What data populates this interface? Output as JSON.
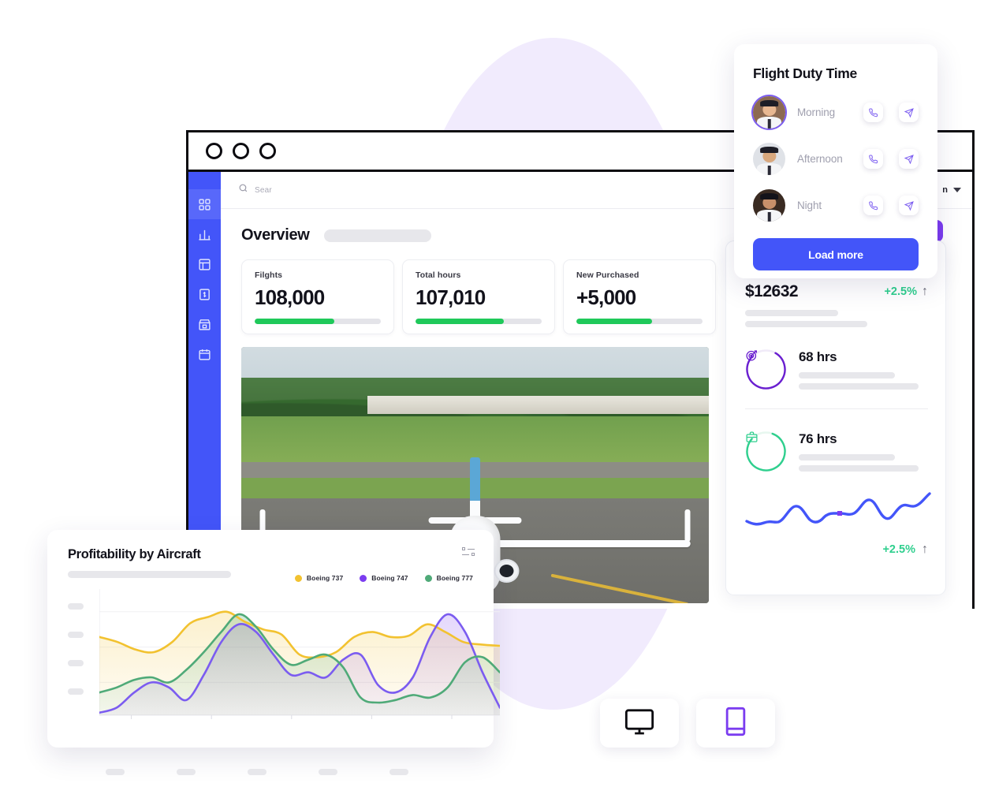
{
  "browser": {
    "window_dots": [
      "dot-1",
      "dot-2",
      "dot-3"
    ]
  },
  "sidebar": {
    "items": [
      {
        "name": "dashboard",
        "icon": "grid-icon",
        "active": true
      },
      {
        "name": "analytics",
        "icon": "bar-chart-icon",
        "active": false
      },
      {
        "name": "table",
        "icon": "table-icon",
        "active": false
      },
      {
        "name": "billing",
        "icon": "invoice-icon",
        "active": false
      },
      {
        "name": "store",
        "icon": "storefront-icon",
        "active": false
      },
      {
        "name": "calendar",
        "icon": "calendar-icon",
        "active": false
      }
    ]
  },
  "topbar": {
    "search_placeholder": "Sear",
    "search_value": "",
    "user_name": "n",
    "dropdown_icon": "chevron-down-icon"
  },
  "overview": {
    "title": "Overview",
    "cards": [
      {
        "label": "Filghts",
        "value": "108,000",
        "progress": 63,
        "color": "#1fc95a"
      },
      {
        "label": "Total hours",
        "value": "107,010",
        "progress": 70,
        "color": "#1fc95a"
      },
      {
        "label": "New Purchased",
        "value": "+5,000",
        "progress": 60,
        "color": "#1fc95a"
      }
    ]
  },
  "photo": {
    "alt": "airplane-on-runway"
  },
  "right_panel": {
    "amount": "$12632",
    "amount_delta": "+2.5%",
    "amount_delta_icon": "arrow-up-icon",
    "metrics": [
      {
        "value": "68 hrs",
        "icon": "target-icon",
        "ring_color": "#6a1fd0",
        "ring_pct": 78
      },
      {
        "value": "76 hrs",
        "icon": "briefcase-icon",
        "ring_color": "#2fcf8e",
        "ring_pct": 80
      }
    ],
    "spark_delta": "+2.5%",
    "spark_delta_icon": "arrow-up-icon",
    "spark_color": "#4355f9",
    "spark_marker_color": "#7b3cf0"
  },
  "duty_card": {
    "title": "Flight Duty Time",
    "rows": [
      {
        "label": "Morning",
        "avatar": "pilot-avatar-morning",
        "bg": "#8c6a52",
        "skin": "#e8b892",
        "highlight": true,
        "call_icon": "phone-icon",
        "send_icon": "send-icon"
      },
      {
        "label": "Afternoon",
        "avatar": "pilot-avatar-afternoon",
        "bg": "#dfe2e7",
        "skin": "#d8a87e",
        "highlight": false,
        "call_icon": "phone-icon",
        "send_icon": "send-icon"
      },
      {
        "label": "Night",
        "avatar": "pilot-avatar-night",
        "bg": "#3a2b22",
        "skin": "#c8906a",
        "highlight": false,
        "call_icon": "phone-icon",
        "send_icon": "send-icon"
      }
    ],
    "load_more_label": "Load more",
    "accent": "#4355f9"
  },
  "device_toggle": [
    {
      "name": "desktop",
      "icon": "monitor-icon",
      "color": "#0c0b10",
      "active": false
    },
    {
      "name": "mobile",
      "icon": "phone-device-icon",
      "color": "#7b3cf0",
      "active": true
    }
  ],
  "chart_data": {
    "type": "area",
    "title": "Profitability by Aircraft",
    "xlabel": "",
    "ylabel": "",
    "grid": true,
    "legend_position": "top-right",
    "x": [
      0,
      1,
      2,
      3,
      4,
      5,
      6,
      7,
      8,
      9,
      10,
      11,
      12,
      13,
      14,
      15,
      16,
      17,
      18,
      19,
      20
    ],
    "ylim": [
      0,
      100
    ],
    "categories": [
      "",
      "",
      "",
      "",
      "",
      ""
    ],
    "series": [
      {
        "name": "Boeing 737",
        "color": "#f2c230",
        "values": [
          62,
          58,
          52,
          50,
          58,
          73,
          78,
          82,
          74,
          68,
          64,
          48,
          46,
          50,
          62,
          66,
          62,
          63,
          72,
          66,
          58,
          56,
          55
        ]
      },
      {
        "name": "Boeing 747",
        "color": "#7b5cf0",
        "values": [
          2,
          6,
          18,
          26,
          22,
          12,
          32,
          58,
          72,
          66,
          48,
          32,
          34,
          30,
          44,
          48,
          24,
          18,
          30,
          62,
          80,
          66,
          34,
          6
        ]
      },
      {
        "name": "Boeing 777",
        "color": "#4faa78",
        "values": [
          18,
          22,
          28,
          30,
          26,
          36,
          50,
          66,
          80,
          70,
          52,
          40,
          44,
          48,
          38,
          14,
          10,
          12,
          16,
          14,
          22,
          42,
          46,
          34
        ]
      }
    ]
  }
}
